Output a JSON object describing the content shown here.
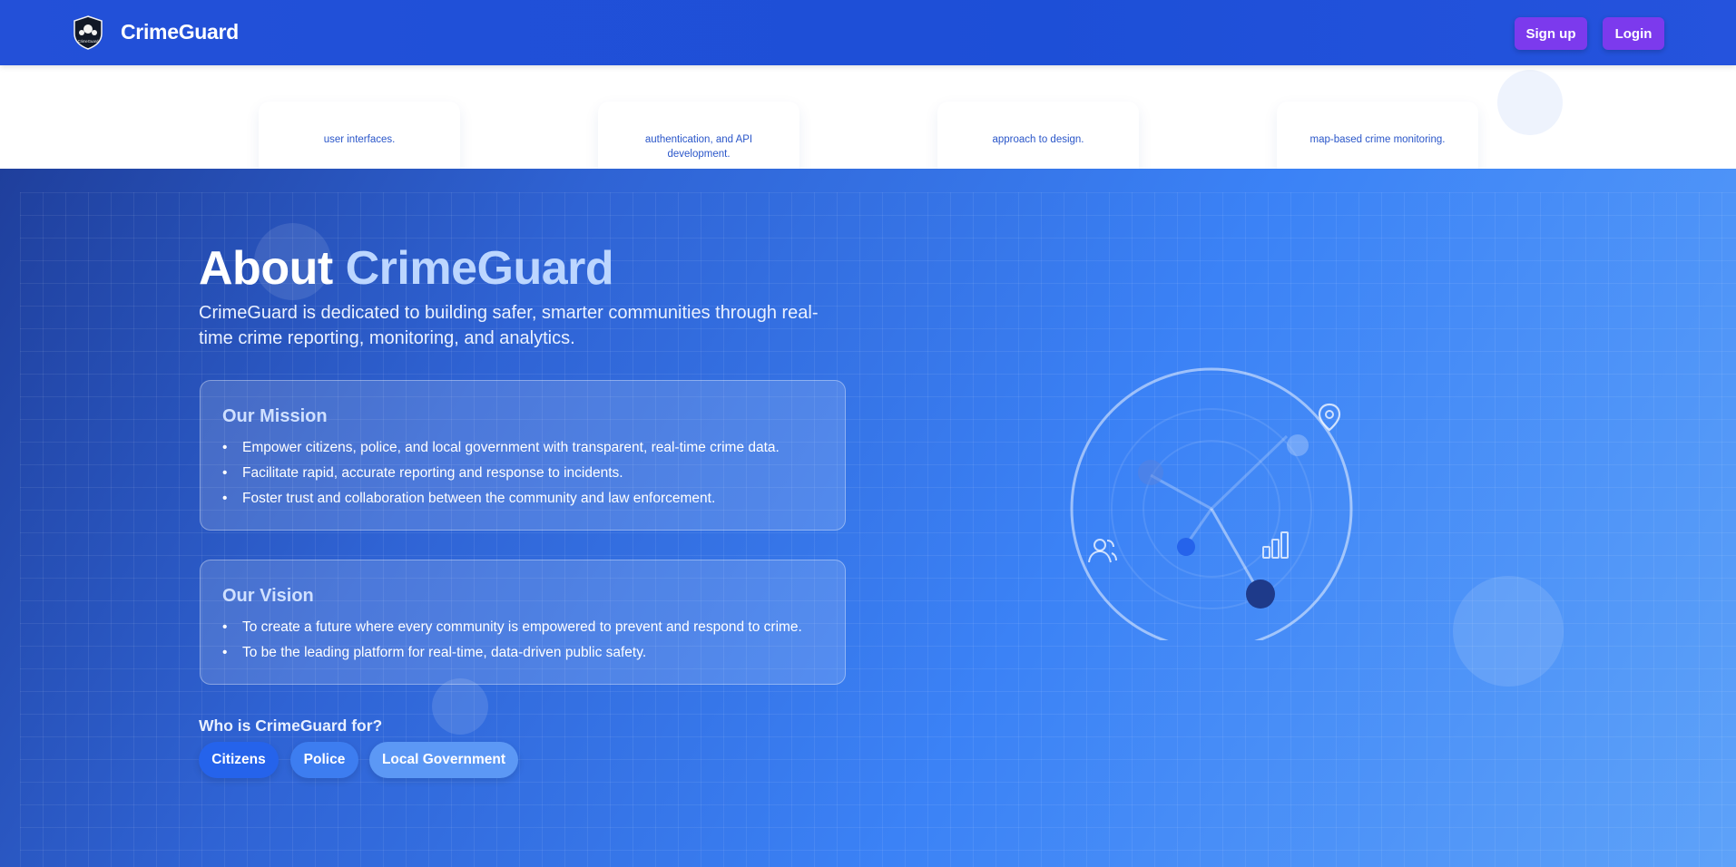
{
  "navbar": {
    "brand": "CrimeGuard",
    "logo_text": "CrimeGuard",
    "signup_label": "Sign up",
    "login_label": "Login"
  },
  "feature_cards": [
    {
      "text": "user interfaces."
    },
    {
      "text": "authentication, and API development."
    },
    {
      "text": "approach to design."
    },
    {
      "text": "map-based crime monitoring."
    }
  ],
  "about": {
    "title_prefix": "About",
    "title_highlight": "CrimeGuard",
    "description": "CrimeGuard is dedicated to building safer, smarter communities through real-time crime reporting, monitoring, and analytics.",
    "mission": {
      "heading": "Our Mission",
      "items": [
        "Empower citizens, police, and local government with transparent, real-time crime data.",
        "Facilitate rapid, accurate reporting and response to incidents.",
        "Foster trust and collaboration between the community and law enforcement."
      ]
    },
    "vision": {
      "heading": "Our Vision",
      "items": [
        "To create a future where every community is empowered to prevent and respond to crime.",
        "To be the leading platform for real-time, data-driven public safety."
      ]
    },
    "audience_heading": "Who is CrimeGuard for?",
    "audiences": [
      "Citizens",
      "Police",
      "Local Government"
    ]
  },
  "illustration": {
    "icons": [
      "location-pin-icon",
      "users-icon",
      "bar-chart-icon"
    ]
  },
  "colors": {
    "navbar": "#1d4fd7",
    "button": "#7c3aed",
    "title_highlight": "#bcd6ff",
    "card_text": "#2a56c9",
    "pill_citizens": "#2563eb",
    "pill_police": "#3d7df0",
    "pill_local": "#5c98f5"
  }
}
